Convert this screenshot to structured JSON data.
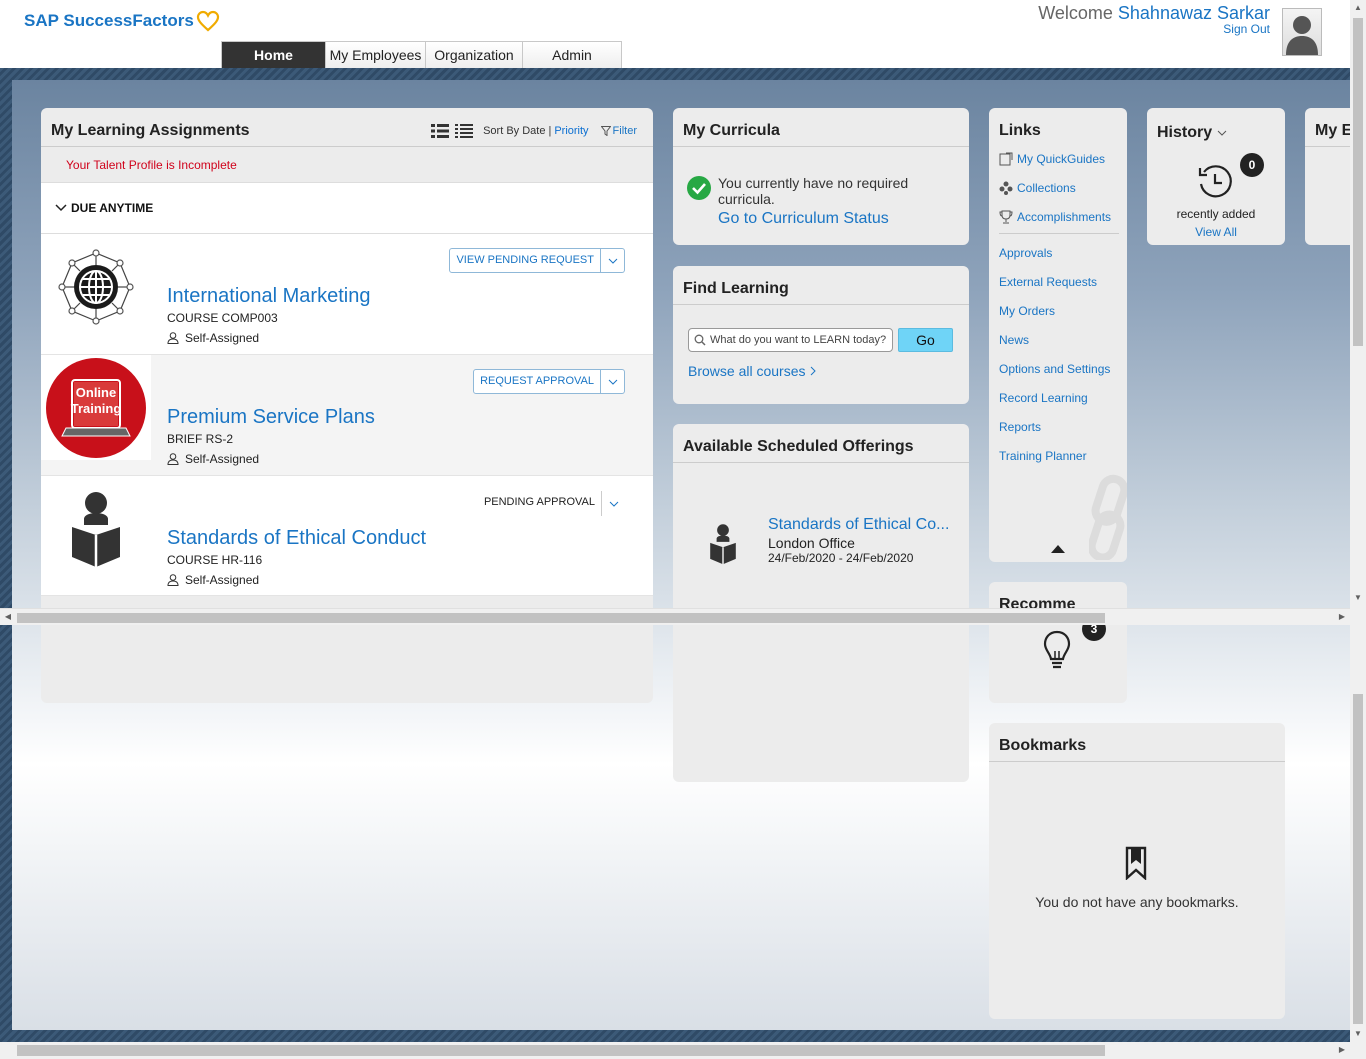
{
  "header": {
    "brand": "SAP SuccessFactors",
    "welcome_prefix": "Welcome",
    "user_name": "Shahnawaz Sarkar",
    "sign_out": "Sign Out"
  },
  "nav": {
    "tabs": [
      {
        "label": "Home",
        "active": true
      },
      {
        "label": "My Employees"
      },
      {
        "label": "Organization"
      },
      {
        "label": "Admin"
      }
    ]
  },
  "learning": {
    "title": "My Learning Assignments",
    "sort_label": "Sort By Date",
    "sort_sep": "|",
    "sort_priority": "Priority",
    "filter": "Filter",
    "warning": "Your Talent Profile is Incomplete",
    "group": "DUE ANYTIME",
    "courses": [
      {
        "title": "International Marketing",
        "code": "COURSE COMP003",
        "assigned": "Self-Assigned",
        "action": "VIEW PENDING REQUEST"
      },
      {
        "title": "Premium Service Plans",
        "code": "BRIEF RS-2",
        "assigned": "Self-Assigned",
        "action": "REQUEST APPROVAL",
        "thumb_line1": "Online",
        "thumb_line2": "Training"
      },
      {
        "title": "Standards of Ethical Conduct",
        "code": "COURSE HR-116",
        "assigned": "Self-Assigned",
        "action": "PENDING APPROVAL"
      }
    ]
  },
  "curricula": {
    "title": "My Curricula",
    "message": "You currently have no required curricula.",
    "link": "Go to Curriculum Status"
  },
  "find_learning": {
    "title": "Find Learning",
    "placeholder": "What do you want to LEARN today?",
    "go": "Go",
    "browse": "Browse all courses"
  },
  "offerings": {
    "title": "Available Scheduled Offerings",
    "item": {
      "title": "Standards of Ethical Co...",
      "location": "London Office",
      "dates": "24/Feb/2020 - 24/Feb/2020"
    }
  },
  "links": {
    "title": "Links",
    "top_items": [
      {
        "label": "My QuickGuides",
        "icon": "guide-icon"
      },
      {
        "label": "Collections",
        "icon": "collections-icon"
      },
      {
        "label": "Accomplishments",
        "icon": "trophy-icon"
      }
    ],
    "items": [
      "Approvals",
      "External Requests",
      "My Orders",
      "News",
      "Options and Settings",
      "Record Learning",
      "Reports",
      "Training Planner"
    ]
  },
  "history": {
    "title": "History",
    "count": "0",
    "label": "recently added",
    "view_all": "View All"
  },
  "my_e": {
    "title": "My E"
  },
  "recommend": {
    "title": "Recomme",
    "count": "3"
  },
  "bookmarks": {
    "title": "Bookmarks",
    "message": "You do not have any bookmarks."
  },
  "colors": {
    "accent": "#1a75c4",
    "warning": "#d0021b",
    "go_button": "#6fd4f7",
    "success": "#27a844"
  }
}
